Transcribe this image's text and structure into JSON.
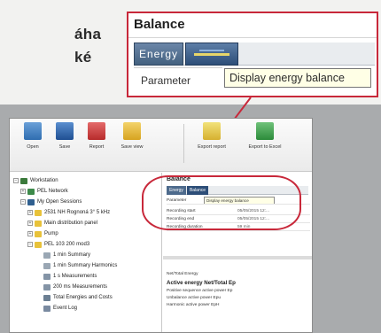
{
  "article": {
    "lines": [
      "áha",
      "ké"
    ]
  },
  "zoom": {
    "title": "Balance",
    "tab_energy": "Energy",
    "tooltip": "Display energy balance",
    "param_label": "Parameter"
  },
  "toolbar": {
    "buttons": [
      {
        "label": "Open",
        "icon": "folder-icon"
      },
      {
        "label": "Save",
        "icon": "save-icon"
      },
      {
        "label": "Report",
        "icon": "report-icon"
      },
      {
        "label": "Save view",
        "icon": "save-view-icon"
      },
      {
        "label": "Export report",
        "icon": "export-report-icon"
      },
      {
        "label": "Export to Excel",
        "icon": "excel-icon"
      }
    ]
  },
  "tree": {
    "items": [
      {
        "label": "Workstation",
        "indent": 0,
        "icon": "workstation-icon"
      },
      {
        "label": "PEL Network",
        "indent": 1,
        "icon": "network-icon"
      },
      {
        "label": "My Open Sessions",
        "indent": 1,
        "icon": "sessions-icon"
      },
      {
        "label": "2531 NH Rognoná 3° 5 kHz",
        "indent": 2,
        "icon": "folder-icon"
      },
      {
        "label": "Main distribution panel",
        "indent": 2,
        "icon": "folder-icon"
      },
      {
        "label": "Pump",
        "indent": 2,
        "icon": "folder-icon"
      },
      {
        "label": "PEL 103 200 mod3",
        "indent": 2,
        "icon": "folder-icon"
      },
      {
        "label": "1 min Summary",
        "indent": 3,
        "icon": "summary-icon"
      },
      {
        "label": "1 min Summary Harmonics",
        "indent": 3,
        "icon": "summary-icon"
      },
      {
        "label": "1 s Measurements",
        "indent": 3,
        "icon": "measure-icon"
      },
      {
        "label": "200 ms Measurements",
        "indent": 3,
        "icon": "measure-icon"
      },
      {
        "label": "Total Energies and Costs",
        "indent": 3,
        "icon": "energy-icon"
      },
      {
        "label": "Event Log",
        "indent": 3,
        "icon": "log-icon"
      }
    ]
  },
  "right": {
    "title": "Balance",
    "tab_energy": "Energy",
    "tab_balance": "Balance",
    "tooltip": "Display energy balance",
    "rows": [
      {
        "k": "Parameter",
        "v": ""
      },
      {
        "k": "Recording start",
        "v": "05/05/2015 12:..."
      },
      {
        "k": "Recording end",
        "v": "05/05/2015 12:..."
      },
      {
        "k": "Recording duration",
        "v": "59 min"
      }
    ],
    "section_title": "Net/Total Energy",
    "section_head": "Active energy Net/Total Ep",
    "lines": [
      "Positive sequence active power Ep",
      "Unbalance active power Epu",
      "Harmonic active power EpH"
    ]
  },
  "colors": {
    "highlight": "#c8283a",
    "tab_blue": "#2d4e78",
    "tooltip_bg": "#ffffe6"
  }
}
